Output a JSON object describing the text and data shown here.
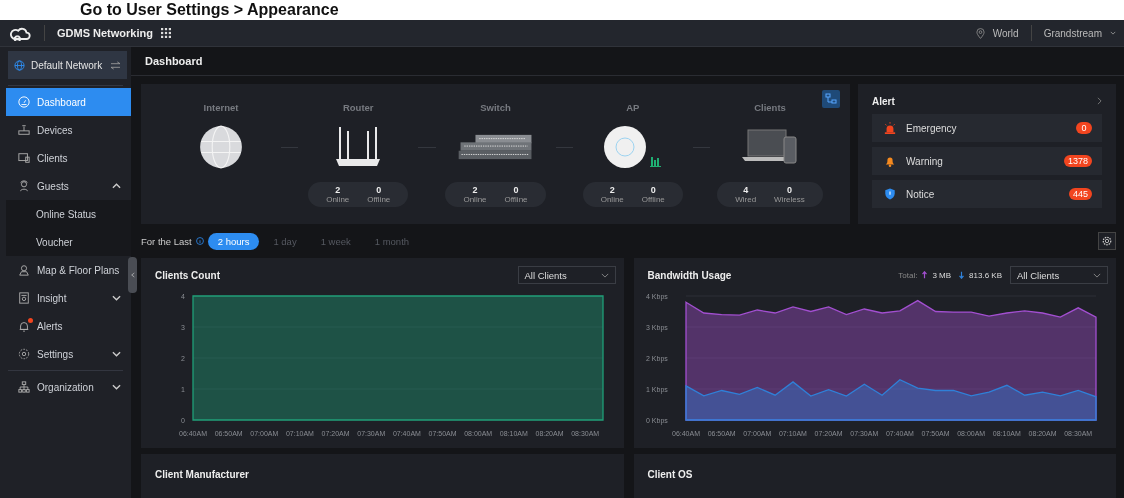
{
  "banner": {
    "text": "Go to User Settings > Appearance"
  },
  "topbar": {
    "app_name": "GDMS Networking",
    "location": "World",
    "account": "Grandstream"
  },
  "sidebar": {
    "network": "Default Network",
    "items": [
      {
        "kind": "dashboard",
        "label": "Dashboard",
        "selected": true
      },
      {
        "kind": "devices",
        "label": "Devices",
        "selected": false
      },
      {
        "kind": "clients",
        "label": "Clients",
        "selected": false
      },
      {
        "kind": "guests",
        "label": "Guests",
        "selected": false,
        "expanded": true,
        "children": [
          {
            "label": "Online Status",
            "selected": false
          },
          {
            "label": "Voucher",
            "selected": false
          }
        ]
      },
      {
        "kind": "map",
        "label": "Map & Floor Plans",
        "selected": false
      },
      {
        "kind": "insight",
        "label": "Insight",
        "selected": false,
        "expanded": false
      },
      {
        "kind": "alerts",
        "label": "Alerts",
        "selected": false,
        "alert_dot": true
      },
      {
        "kind": "settings",
        "label": "Settings",
        "selected": false,
        "expanded": false
      },
      {
        "kind": "organization",
        "label": "Organization",
        "selected": false,
        "expanded": false
      }
    ]
  },
  "page": {
    "title": "Dashboard"
  },
  "topology": {
    "nodes": [
      {
        "kind": "globe",
        "label": "Internet"
      },
      {
        "kind": "router",
        "label": "Router",
        "stats": [
          {
            "value": "2",
            "label": "Online"
          },
          {
            "value": "0",
            "label": "Offline"
          }
        ]
      },
      {
        "kind": "switch",
        "label": "Switch",
        "stats": [
          {
            "value": "2",
            "label": "Online"
          },
          {
            "value": "0",
            "label": "Offline"
          }
        ]
      },
      {
        "kind": "ap",
        "label": "AP",
        "stats": [
          {
            "value": "2",
            "label": "Online"
          },
          {
            "value": "0",
            "label": "Offline"
          }
        ]
      },
      {
        "kind": "clients",
        "label": "Clients",
        "stats": [
          {
            "value": "4",
            "label": "Wired"
          },
          {
            "value": "0",
            "label": "Wireless"
          }
        ]
      }
    ]
  },
  "alert": {
    "title": "Alert",
    "items": [
      {
        "kind": "emergency",
        "label": "Emergency",
        "count": "0"
      },
      {
        "kind": "warning",
        "label": "Warning",
        "count": "1378"
      },
      {
        "kind": "notice",
        "label": "Notice",
        "count": "445"
      }
    ]
  },
  "time_filter": {
    "label": "For the Last",
    "options": [
      {
        "label": "2 hours",
        "selected": true
      },
      {
        "label": "1 day",
        "selected": false
      },
      {
        "label": "1 week",
        "selected": false
      },
      {
        "label": "1 month",
        "selected": false
      }
    ]
  },
  "clients_count": {
    "title": "Clients Count",
    "filter": "All Clients",
    "chart_data": {
      "type": "area",
      "categories": [
        "06:40AM",
        null,
        "06:50AM",
        null,
        "07:00AM",
        null,
        "07:10AM",
        null,
        "07:20AM",
        null,
        "07:30AM",
        null,
        "07:40AM",
        null,
        "07:50AM",
        null,
        "08:00AM",
        null,
        "08:10AM",
        null,
        "08:20AM",
        null,
        "08:30AM",
        null
      ],
      "ylim": [
        0,
        4
      ],
      "yticks": [
        0,
        1,
        2,
        3,
        4
      ],
      "series": [
        {
          "color": "#1f9e77",
          "values": [
            4,
            4,
            4,
            4,
            4,
            4,
            4,
            4,
            4,
            4,
            4,
            4,
            4,
            4,
            4,
            4,
            4,
            4,
            4,
            4,
            4,
            4,
            4,
            4
          ]
        }
      ]
    }
  },
  "bandwidth": {
    "title": "Bandwidth Usage",
    "total_label": "Total:",
    "upload": "3 MB",
    "download": "813.6 KB",
    "filter": "All Clients",
    "chart_data": {
      "type": "area",
      "categories": [
        "06:40AM",
        null,
        "06:50AM",
        null,
        "07:00AM",
        null,
        "07:10AM",
        null,
        "07:20AM",
        null,
        "07:30AM",
        null,
        "07:40AM",
        null,
        "07:50AM",
        null,
        "08:00AM",
        null,
        "08:10AM",
        null,
        "08:20AM",
        null,
        "08:30AM",
        null
      ],
      "ylim": [
        0,
        4
      ],
      "yticks": [
        {
          "value": 0,
          "label": "0 Kbps"
        },
        {
          "value": 1,
          "label": "1 Kbps"
        },
        {
          "value": 2,
          "label": "2 Kbps"
        },
        {
          "value": 3,
          "label": "3 Kbps"
        },
        {
          "value": 4,
          "label": "4 Kbps"
        }
      ],
      "stacked": false,
      "series": [
        {
          "color": "#a24fd0",
          "values": [
            3.8,
            3.45,
            3.4,
            3.38,
            3.55,
            3.45,
            3.65,
            3.5,
            3.65,
            3.4,
            3.58,
            3.45,
            3.52,
            3.85,
            3.5,
            3.48,
            3.48,
            3.35,
            3.45,
            3.52,
            3.45,
            3.32,
            3.62,
            3.32
          ]
        },
        {
          "color": "#2f80d8",
          "values": [
            1.1,
            0.78,
            0.95,
            0.83,
            1.05,
            0.8,
            1.23,
            0.77,
            0.98,
            0.77,
            1.15,
            0.8,
            1.3,
            1.03,
            0.95,
            0.95,
            0.78,
            0.9,
            1.12,
            0.8,
            0.9,
            0.78,
            0.95,
            0.75
          ]
        }
      ]
    }
  },
  "bottom_cards": [
    {
      "title": "Client Manufacturer"
    },
    {
      "title": "Client OS"
    }
  ]
}
